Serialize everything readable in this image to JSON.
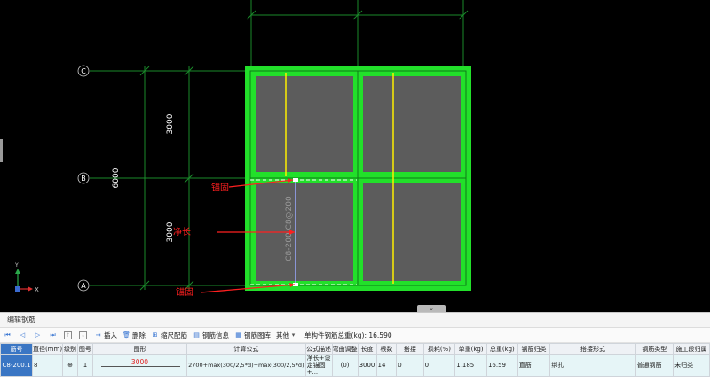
{
  "drawing": {
    "axis_labels": [
      "C",
      "B",
      "A"
    ],
    "dim_span_top": "3000",
    "dim_span_bottom": "3000",
    "dim_total": "6000",
    "rebar_label": "C8-200  C8@200",
    "annotations": {
      "anchor_top": "锚固",
      "net_length": "净长",
      "anchor_bottom": "锚固"
    },
    "ucs_x_label": "X",
    "ucs_y_label": "Y",
    "colors": {
      "background": "#000000",
      "slab_fill": "#5a5a5a",
      "beam": "#22e02a",
      "highlight_bar": "#ffee00",
      "selected_bar": "#9aa8ff",
      "annotation": "#ff2020",
      "axis_lines": "#1a8a2a"
    }
  },
  "panel": {
    "title": "编辑钢筋",
    "toolbar": {
      "insert": "插入",
      "delete": "删除",
      "scale_rebar": "缩尺配筋",
      "rebar_info": "钢筋信息",
      "rebar_library": "钢筋图库",
      "other": "其他",
      "total_weight": "单构件钢筋总重(kg): 16.590"
    },
    "columns": [
      "筋号",
      "直径(mm)",
      "级别",
      "图号",
      "图形",
      "计算公式",
      "公式描述",
      "弯曲调整",
      "长度",
      "根数",
      "搭接",
      "损耗(%)",
      "单重(kg)",
      "总重(kg)",
      "钢筋归类",
      "搭接形式",
      "钢筋类型",
      "施工段归属"
    ],
    "rows": [
      {
        "bar_no": "C8-200.1",
        "diameter": "8",
        "grade": "⊕",
        "shape_no": "1",
        "shape_length": "3000",
        "formula": "2700+max(300/2,5*d)+max(300/2,5*d)",
        "description": "净长+设定锚固+...",
        "bend_adjust": "(0)",
        "length": "3000",
        "count": "14",
        "lap": "0",
        "loss": "0",
        "unit_weight": "1.185",
        "total_weight": "16.59",
        "category": "直筋",
        "lap_type": "绑扎",
        "rebar_type": "普通钢筋",
        "stage": "未归类"
      }
    ]
  }
}
